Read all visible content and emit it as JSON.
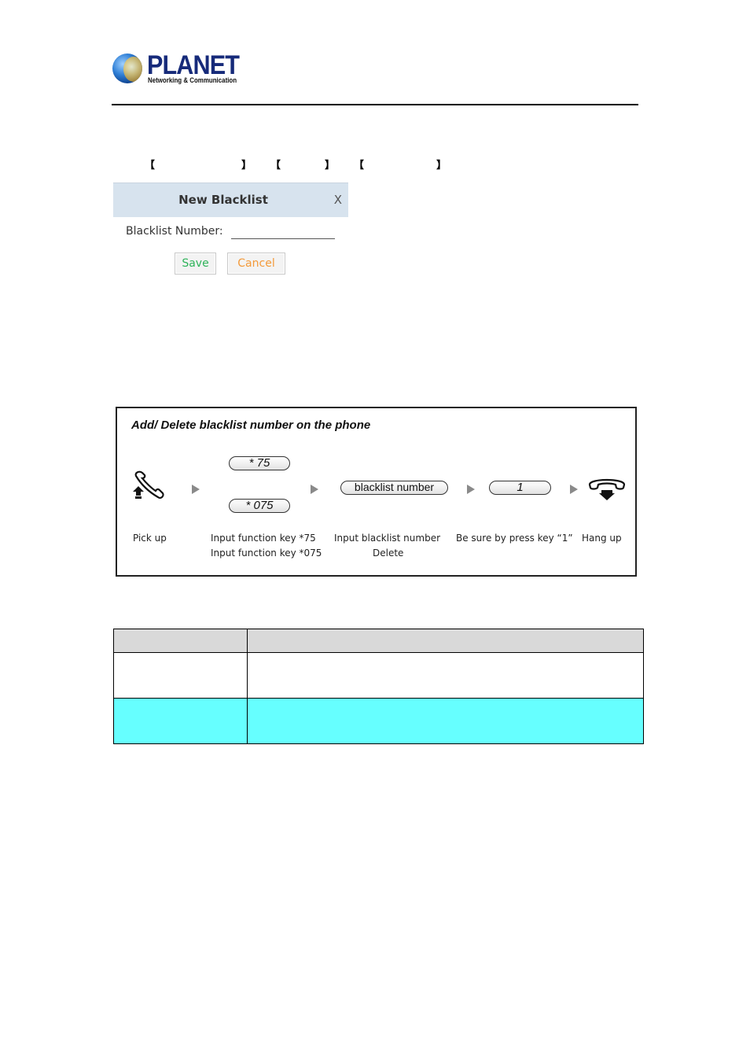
{
  "header": {
    "logo": {
      "brand": "PLANET",
      "tagline": "Networking & Communication"
    }
  },
  "path": {
    "brackets": [
      {
        "open": "【",
        "text": "",
        "close": "】"
      },
      {
        "open": "【",
        "text": "",
        "close": "】"
      },
      {
        "open": "【",
        "text": "",
        "close": "】"
      }
    ]
  },
  "dialog": {
    "title": "New Blacklist",
    "close_label": "X",
    "field_label": "Blacklist Number:",
    "field_value": "",
    "save_label": "Save",
    "cancel_label": "Cancel",
    "colors": {
      "header_bg": "#d7e3ee",
      "save_text": "#2fb35a",
      "cancel_text": "#f39a3a"
    }
  },
  "diagram": {
    "title": "Add/ Delete blacklist number on the phone",
    "steps": [
      {
        "icon": "phone-pickup-icon",
        "label_lines": [
          "Pick up"
        ]
      },
      {
        "keys": [
          "* 75",
          "* 075"
        ],
        "label_lines": [
          "Input function key *75",
          "Input function key *075"
        ]
      },
      {
        "keys": [
          "blacklist  number"
        ],
        "label_lines": [
          "Input blacklist number",
          "Delete"
        ]
      },
      {
        "keys": [
          "1"
        ],
        "label_lines": [
          "Be sure by press key “1”"
        ]
      },
      {
        "icon": "phone-hangup-icon",
        "label_lines": [
          "Hang up"
        ]
      }
    ]
  },
  "table": {
    "header": [
      "",
      ""
    ],
    "rows": [
      {
        "cells": [
          "",
          ""
        ],
        "bg": "#ffffff"
      },
      {
        "cells": [
          "",
          ""
        ],
        "bg": "#66ffff"
      }
    ],
    "header_bg": "#d9d9d9"
  }
}
